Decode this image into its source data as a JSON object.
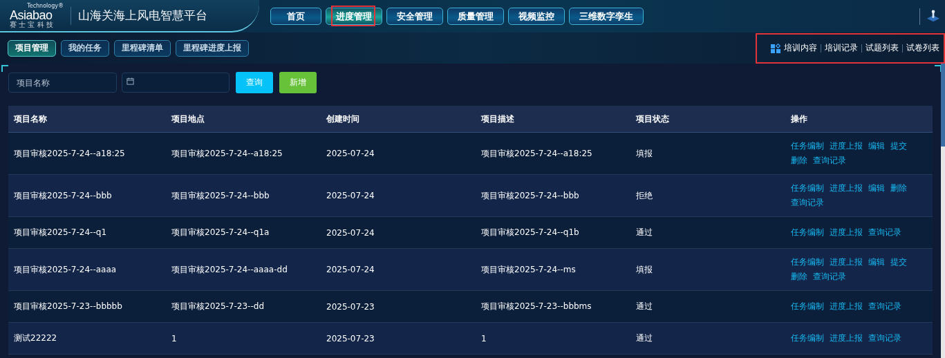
{
  "header": {
    "logo_text": "Asiabao",
    "logo_sup": "Technology®",
    "logo_sub": "赛 士 宝 科 技",
    "title": "山海关海上风电智慧平台"
  },
  "nav": [
    {
      "label": "首页",
      "selected": false,
      "highlighted": false
    },
    {
      "label": "进度管理",
      "selected": true,
      "highlighted": true
    },
    {
      "label": "安全管理",
      "selected": false,
      "highlighted": false
    },
    {
      "label": "质量管理",
      "selected": false,
      "highlighted": false
    },
    {
      "label": "视频监控",
      "selected": false,
      "highlighted": false
    },
    {
      "label": "三维数字孪生",
      "selected": false,
      "highlighted": false
    }
  ],
  "subtabs": [
    {
      "label": "项目管理",
      "selected": true
    },
    {
      "label": "我的任务",
      "selected": false
    },
    {
      "label": "里程碑清单",
      "selected": false
    },
    {
      "label": "里程碑进度上报",
      "selected": false
    }
  ],
  "quick_links": {
    "highlighted": true,
    "items": [
      "培训内容",
      "培训记录",
      "试题列表",
      "试卷列表"
    ]
  },
  "filters": {
    "name_placeholder": "项目名称",
    "buttons": [
      {
        "label": "查询",
        "kind": "primary"
      },
      {
        "label": "新增",
        "kind": "success"
      }
    ]
  },
  "table": {
    "columns": [
      "项目名称",
      "项目地点",
      "创建时间",
      "项目描述",
      "项目状态",
      "操作"
    ],
    "rows": [
      {
        "cells": [
          "项目审核2025-7-24--a18:25",
          "项目审核2025-7-24--a18:25",
          "2025-07-24",
          "项目审核2025-7-24--a18:25",
          "填报"
        ],
        "actions": [
          "任务编制",
          "进度上报",
          "编辑",
          "提交",
          "删除",
          "查询记录"
        ]
      },
      {
        "cells": [
          "项目审核2025-7-24--bbb",
          "项目审核2025-7-24--bbb",
          "2025-07-24",
          "项目审核2025-7-24--bbb",
          "拒绝"
        ],
        "actions": [
          "任务编制",
          "进度上报",
          "编辑",
          "删除",
          "查询记录"
        ]
      },
      {
        "cells": [
          "项目审核2025-7-24--q1",
          "项目审核2025-7-24--q1a",
          "2025-07-24",
          "项目审核2025-7-24--q1b",
          "通过"
        ],
        "actions": [
          "任务编制",
          "进度上报",
          "查询记录"
        ]
      },
      {
        "cells": [
          "项目审核2025-7-24--aaaa",
          "项目审核2025-7-24--aaaa-dd",
          "2025-07-24",
          "项目审核2025-7-24--ms",
          "填报"
        ],
        "actions": [
          "任务编制",
          "进度上报",
          "编辑",
          "提交",
          "删除",
          "查询记录"
        ]
      },
      {
        "cells": [
          "项目审核2025-7-23--bbbbb",
          "项目审核2025-7-23--dd",
          "2025-07-23",
          "项目审核2025-7-23--bbbms",
          "通过"
        ],
        "actions": [
          "任务编制",
          "进度上报",
          "查询记录"
        ]
      },
      {
        "cells": [
          "测试22222",
          "1",
          "2025-07-23",
          "1",
          "通过"
        ],
        "actions": [
          "任务编制",
          "进度上报",
          "查询记录"
        ]
      }
    ]
  }
}
